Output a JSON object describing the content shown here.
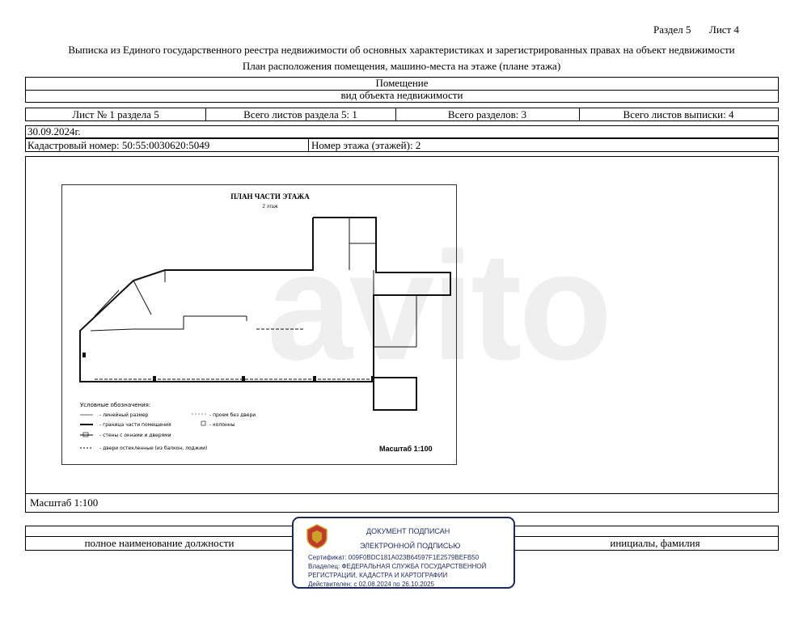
{
  "header": {
    "section": "Раздел 5",
    "sheet": "Лист 4",
    "title_line1": "Выписка из Единого государственного реестра недвижимости об основных характеристиках и зарегистрированных правах на объект недвижимости",
    "title_line2": "План расположения помещения, машино-места на этаже (плане этажа)"
  },
  "object": {
    "name": "Помещение",
    "kind_label": "вид объекта недвижимости"
  },
  "sheets": {
    "sheet_of_section": "Лист № 1 раздела 5",
    "total_section_sheets": "Всего листов раздела 5: 1",
    "total_sections": "Всего разделов: 3",
    "total_extract_sheets": "Всего листов выписки: 4"
  },
  "date": "30.09.2024г.",
  "cadastral": "Кадастровый номер: 50:55:0030620:5049",
  "floor": "Номер этажа (этажей): 2",
  "plan": {
    "title": "ПЛАН ЧАСТИ ЭТАЖА",
    "subtitle": "2 этаж",
    "scale_label": "Масштаб 1:100",
    "legend_title": "Условные обозначения:",
    "legend_items": [
      "- линейный размер",
      "- граница части помещения",
      "- стены с окнами и дверями",
      "- двери остекленные (из балкон, лоджии)",
      "- проем без двери",
      "- колонны"
    ]
  },
  "scale_footer": "Масштаб 1:100",
  "signature": {
    "position_label": "полное наименование должности",
    "initials_label": "инициалы, фамилия"
  },
  "stamp": {
    "line1": "ДОКУМЕНТ ПОДПИСАН",
    "line2": "ЭЛЕКТРОННОЙ ПОДПИСЬЮ",
    "certificate": "Сертификат: 009F0BDC181A023B64597F1E2579BEFB50",
    "owner1": "Владелец: ФЕДЕРАЛЬНАЯ СЛУЖБА ГОСУДАРСТВЕННОЙ",
    "owner2": "РЕГИСТРАЦИИ, КАДАСТРА И КАРТОГРАФИИ",
    "valid": "Действителен: с 02.08.2024 по 26.10.2025"
  },
  "colors": {
    "stamp_border": "#1f2a5c",
    "emblem_gold": "#c9a227",
    "emblem_red": "#c0392b"
  }
}
